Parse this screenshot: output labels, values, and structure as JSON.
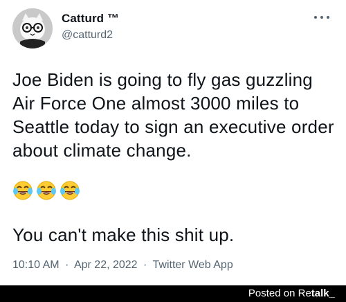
{
  "tweet": {
    "author": {
      "display_name": "Catturd ™",
      "handle": "@catturd2",
      "avatar_icon": "cat-avatar-icon"
    },
    "more_icon": "more-horizontal-icon",
    "text": "Joe Biden is going to fly gas guzzling Air Force One almost 3000 miles to Seattle today to sign an executive order about climate change.",
    "emojis": [
      {
        "icon": "face-with-tears-of-joy-icon"
      },
      {
        "icon": "face-with-tears-of-joy-icon"
      },
      {
        "icon": "face-with-tears-of-joy-icon"
      }
    ],
    "text_2": "You can't make this shit up.",
    "meta": {
      "time": "10:10 AM",
      "separator": "·",
      "date": "Apr 22, 2022",
      "source": "Twitter Web App"
    }
  },
  "footer": {
    "prefix": "Posted on Re",
    "brand": "talk_"
  },
  "colors": {
    "text": "#0f1419",
    "muted": "#536471",
    "footer_bg": "#000000"
  }
}
